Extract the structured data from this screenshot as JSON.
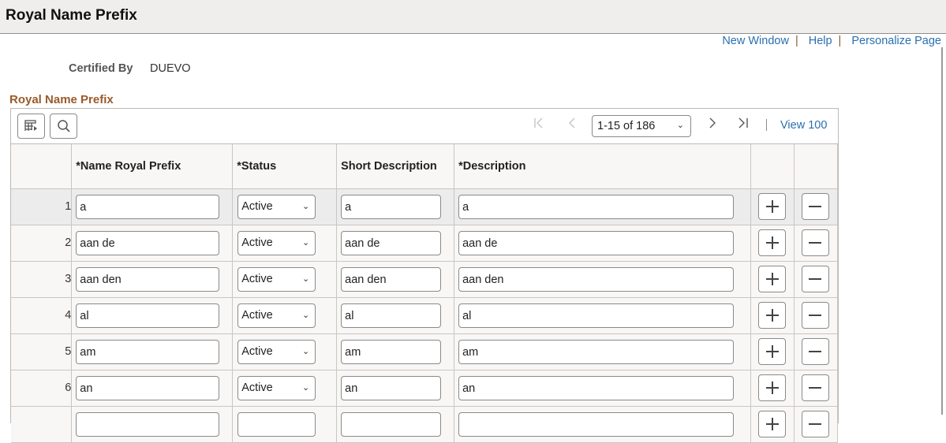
{
  "header": {
    "title": "Royal Name Prefix"
  },
  "top_links": [
    {
      "label": "New Window"
    },
    {
      "label": "Help"
    },
    {
      "label": "Personalize Page"
    }
  ],
  "certified": {
    "label": "Certified By",
    "value": "DUEVO"
  },
  "section": {
    "title": "Royal Name Prefix"
  },
  "grid": {
    "toolbar": {
      "personalize_icon": "grid-personalize-icon",
      "search_icon": "search-icon",
      "pagination": {
        "range": "1-15 of 186",
        "first": "⟨|",
        "prev": "‹",
        "next": "›",
        "last": "|⟩"
      },
      "view_all": "View 100"
    },
    "columns": [
      "",
      "*Name Royal Prefix",
      "*Status",
      "Short Description",
      "*Description",
      "",
      ""
    ],
    "rows": [
      {
        "num": "1",
        "prefix": "a",
        "status": "Active",
        "short": "a",
        "desc": "a"
      },
      {
        "num": "2",
        "prefix": "aan de",
        "status": "Active",
        "short": "aan de",
        "desc": "aan de"
      },
      {
        "num": "3",
        "prefix": "aan den",
        "status": "Active",
        "short": "aan den",
        "desc": "aan den"
      },
      {
        "num": "4",
        "prefix": "al",
        "status": "Active",
        "short": "al",
        "desc": "al"
      },
      {
        "num": "5",
        "prefix": "am",
        "status": "Active",
        "short": "am",
        "desc": "am"
      },
      {
        "num": "6",
        "prefix": "an",
        "status": "Active",
        "short": "an",
        "desc": "an"
      },
      {
        "num": "",
        "prefix": "",
        "status": "",
        "short": "",
        "desc": ""
      }
    ]
  }
}
